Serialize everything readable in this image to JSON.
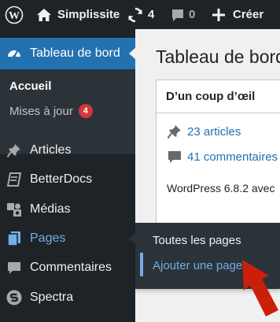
{
  "admin_bar": {
    "site_name": "Simplissite",
    "updates_count": "4",
    "comments_count": "0",
    "new_label": "Créer",
    "icons": [
      "wordpress-logo-icon",
      "home-icon",
      "updates-icon",
      "comment-icon",
      "plus-icon"
    ]
  },
  "sidebar": {
    "current": {
      "label": "Tableau de bord",
      "icon": "dashboard-icon"
    },
    "submenu": {
      "home_label": "Accueil",
      "updates_label": "Mises à jour",
      "updates_badge": "4"
    },
    "items": [
      {
        "label": "Articles",
        "icon": "pin-icon"
      },
      {
        "label": "BetterDocs",
        "icon": "docs-icon"
      },
      {
        "label": "Médias",
        "icon": "media-icon"
      },
      {
        "label": "Pages",
        "icon": "pages-icon"
      },
      {
        "label": "Commentaires",
        "icon": "comment-icon"
      },
      {
        "label": "Spectra",
        "icon": "spectra-icon"
      }
    ],
    "flyout": {
      "items": [
        "Toutes les pages",
        "Ajouter une page"
      ],
      "active": "Ajouter une page"
    }
  },
  "main": {
    "title": "Tableau de bord",
    "widget": {
      "title": "D’un coup d’œil",
      "articles": "23 articles",
      "comments": "41 commentaires",
      "version": "WordPress 6.8.2 avec"
    }
  },
  "colors": {
    "adminbar": "#1d2327",
    "sidebar": "#1d2327",
    "submenu": "#2c3338",
    "accent": "#2271b1",
    "link_hover": "#72aee6",
    "badge": "#d63638",
    "annotation_arrow": "#cc1f0a"
  }
}
